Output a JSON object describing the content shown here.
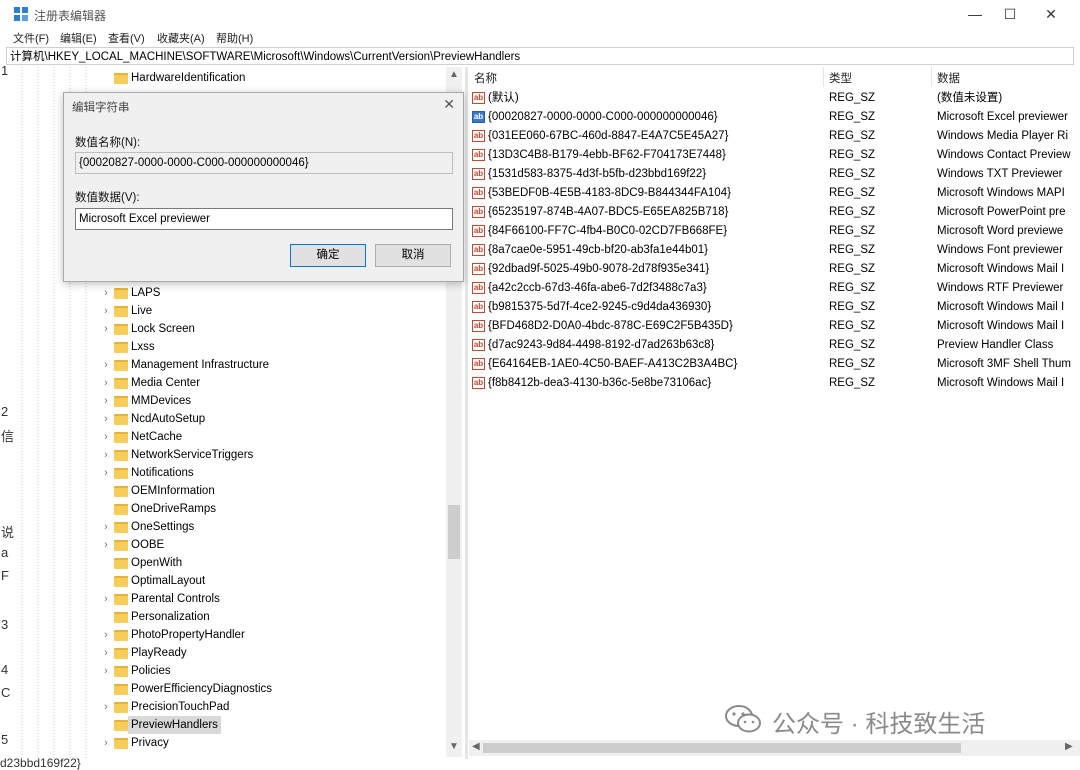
{
  "window": {
    "title": "注册表编辑器",
    "controls": {
      "minimize": "—",
      "maximize": "☐",
      "close": "✕"
    }
  },
  "menu": [
    "文件(F)",
    "编辑(E)",
    "查看(V)",
    "收藏夹(A)",
    "帮助(H)"
  ],
  "address": "计算机\\HKEY_LOCAL_MACHINE\\SOFTWARE\\Microsoft\\Windows\\CurrentVersion\\PreviewHandlers",
  "tree": {
    "top_items": [
      "HardwareIdentification"
    ],
    "items": [
      {
        "label": "LAPS",
        "expandable": true
      },
      {
        "label": "Live",
        "expandable": true
      },
      {
        "label": "Lock Screen",
        "expandable": true
      },
      {
        "label": "Lxss",
        "expandable": false
      },
      {
        "label": "Management Infrastructure",
        "expandable": true
      },
      {
        "label": "Media Center",
        "expandable": true
      },
      {
        "label": "MMDevices",
        "expandable": true
      },
      {
        "label": "NcdAutoSetup",
        "expandable": true
      },
      {
        "label": "NetCache",
        "expandable": true
      },
      {
        "label": "NetworkServiceTriggers",
        "expandable": true
      },
      {
        "label": "Notifications",
        "expandable": true
      },
      {
        "label": "OEMInformation",
        "expandable": false
      },
      {
        "label": "OneDriveRamps",
        "expandable": false
      },
      {
        "label": "OneSettings",
        "expandable": true
      },
      {
        "label": "OOBE",
        "expandable": true
      },
      {
        "label": "OpenWith",
        "expandable": false
      },
      {
        "label": "OptimalLayout",
        "expandable": false
      },
      {
        "label": "Parental Controls",
        "expandable": true
      },
      {
        "label": "Personalization",
        "expandable": false
      },
      {
        "label": "PhotoPropertyHandler",
        "expandable": true
      },
      {
        "label": "PlayReady",
        "expandable": true
      },
      {
        "label": "Policies",
        "expandable": true
      },
      {
        "label": "PowerEfficiencyDiagnostics",
        "expandable": false
      },
      {
        "label": "PrecisionTouchPad",
        "expandable": true
      },
      {
        "label": "PreviewHandlers",
        "expandable": false,
        "selected": true
      },
      {
        "label": "Privacy",
        "expandable": true
      }
    ]
  },
  "list": {
    "columns": {
      "name": "名称",
      "type": "类型",
      "data": "数据"
    },
    "rows": [
      {
        "name": "(默认)",
        "type": "REG_SZ",
        "data": "(数值未设置)"
      },
      {
        "name": "{00020827-0000-0000-C000-000000000046}",
        "type": "REG_SZ",
        "data": "Microsoft Excel previewer",
        "active": true
      },
      {
        "name": "{031EE060-67BC-460d-8847-E4A7C5E45A27}",
        "type": "REG_SZ",
        "data": "Windows Media Player Ri"
      },
      {
        "name": "{13D3C4B8-B179-4ebb-BF62-F704173E7448}",
        "type": "REG_SZ",
        "data": "Windows Contact Preview"
      },
      {
        "name": "{1531d583-8375-4d3f-b5fb-d23bbd169f22}",
        "type": "REG_SZ",
        "data": "Windows TXT Previewer"
      },
      {
        "name": "{53BEDF0B-4E5B-4183-8DC9-B844344FA104}",
        "type": "REG_SZ",
        "data": "Microsoft Windows MAPI"
      },
      {
        "name": "{65235197-874B-4A07-BDC5-E65EA825B718}",
        "type": "REG_SZ",
        "data": "Microsoft PowerPoint pre"
      },
      {
        "name": "{84F66100-FF7C-4fb4-B0C0-02CD7FB668FE}",
        "type": "REG_SZ",
        "data": "Microsoft Word previewe"
      },
      {
        "name": "{8a7cae0e-5951-49cb-bf20-ab3fa1e44b01}",
        "type": "REG_SZ",
        "data": "Windows Font previewer"
      },
      {
        "name": "{92dbad9f-5025-49b0-9078-2d78f935e341}",
        "type": "REG_SZ",
        "data": "Microsoft Windows Mail I"
      },
      {
        "name": "{a42c2ccb-67d3-46fa-abe6-7d2f3488c7a3}",
        "type": "REG_SZ",
        "data": "Windows RTF Previewer"
      },
      {
        "name": "{b9815375-5d7f-4ce2-9245-c9d4da436930}",
        "type": "REG_SZ",
        "data": "Microsoft Windows Mail I"
      },
      {
        "name": "{BFD468D2-D0A0-4bdc-878C-E69C2F5B435D}",
        "type": "REG_SZ",
        "data": "Microsoft Windows Mail I"
      },
      {
        "name": "{d7ac9243-9d84-4498-8192-d7ad263b63c8}",
        "type": "REG_SZ",
        "data": "Preview Handler Class"
      },
      {
        "name": "{E64164EB-1AE0-4C50-BAEF-A413C2B3A4BC}",
        "type": "REG_SZ",
        "data": "Microsoft 3MF Shell Thum"
      },
      {
        "name": "{f8b8412b-dea3-4130-b36c-5e8be73106ac}",
        "type": "REG_SZ",
        "data": "Microsoft Windows Mail I"
      }
    ]
  },
  "dialog": {
    "title": "编辑字符串",
    "close": "✕",
    "name_label": "数值名称(N):",
    "name_value": "{00020827-0000-0000-C000-000000000046}",
    "data_label": "数值数据(V):",
    "data_value": "Microsoft Excel previewer",
    "ok": "确定",
    "cancel": "取消"
  },
  "watermark": "公众号 · 科技致生活",
  "background_fragments": [
    "1",
    "2",
    "信",
    "说",
    "a",
    "F",
    "3",
    "4",
    "C",
    "5"
  ],
  "bottom_fragment": "d23bbd169f22}"
}
